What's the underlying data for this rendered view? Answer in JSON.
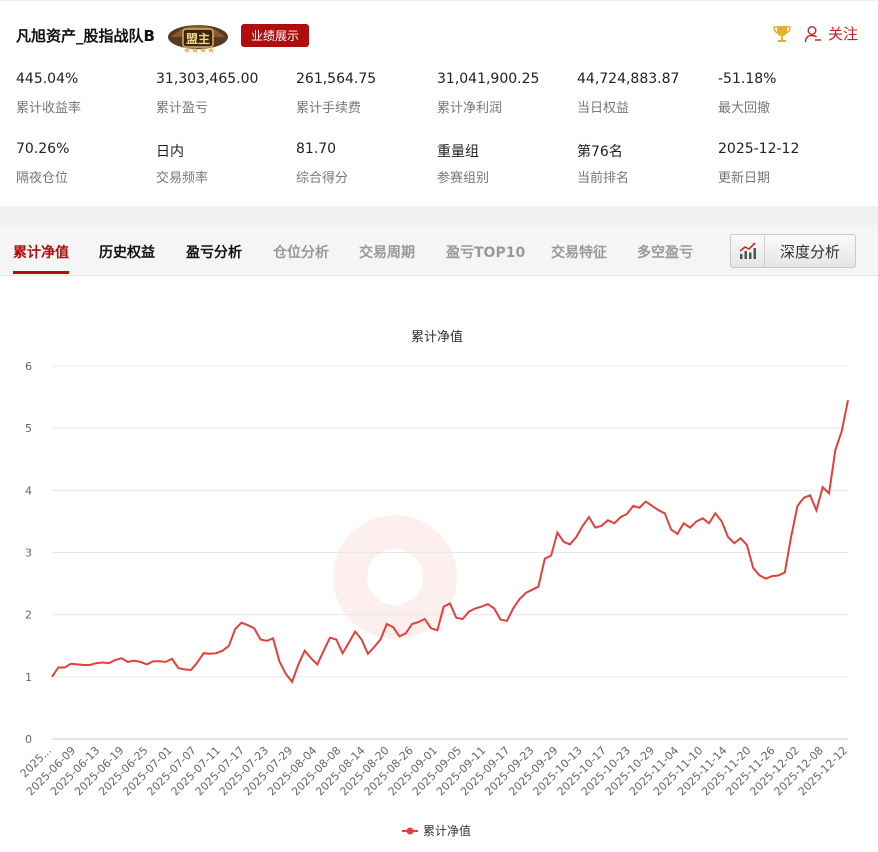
{
  "header": {
    "account_name": "凡旭资产_股指战队B",
    "badge_text": "盟主",
    "performance_button": "业绩展示",
    "follow_label": "关注"
  },
  "stats": [
    {
      "value": "445.04%",
      "label": "累计收益率"
    },
    {
      "value": "31,303,465.00",
      "label": "累计盈亏"
    },
    {
      "value": "261,564.75",
      "label": "累计手续费"
    },
    {
      "value": "31,041,900.25",
      "label": "累计净利润"
    },
    {
      "value": "44,724,883.87",
      "label": "当日权益"
    },
    {
      "value": "-51.18%",
      "label": "最大回撤"
    },
    {
      "value": "70.26%",
      "label": "隔夜仓位"
    },
    {
      "value": "日内",
      "label": "交易频率"
    },
    {
      "value": "81.70",
      "label": "综合得分"
    },
    {
      "value": "重量组",
      "label": "参赛组别"
    },
    {
      "value": "第76名",
      "label": "当前排名"
    },
    {
      "value": "2025-12-12",
      "label": "更新日期"
    }
  ],
  "tabs": [
    {
      "label": "累计净值",
      "state": "active"
    },
    {
      "label": "历史权益",
      "state": "dark"
    },
    {
      "label": "盈亏分析",
      "state": "dark"
    },
    {
      "label": "仓位分析",
      "state": "muted"
    },
    {
      "label": "交易周期",
      "state": "muted"
    },
    {
      "label": "盈亏TOP10",
      "state": "muted"
    },
    {
      "label": "交易特征",
      "state": "muted"
    },
    {
      "label": "多空盈亏",
      "state": "muted"
    }
  ],
  "deep_analysis_label": "深度分析",
  "colors": {
    "accent": "#b00e0e",
    "line": "#e0413b"
  },
  "chart_data": {
    "type": "line",
    "title": "累计净值",
    "legend": "累计净值",
    "legend_position": "bottom",
    "ylim": [
      0,
      6
    ],
    "yticks": [
      0,
      1,
      2,
      3,
      4,
      5,
      6
    ],
    "grid": true,
    "xtick_labels": [
      "2025...",
      "2025-06-09",
      "2025-06-13",
      "2025-06-19",
      "2025-06-25",
      "2025-07-01",
      "2025-07-07",
      "2025-07-11",
      "2025-07-17",
      "2025-07-23",
      "2025-07-29",
      "2025-08-04",
      "2025-08-08",
      "2025-08-14",
      "2025-08-20",
      "2025-08-26",
      "2025-09-01",
      "2025-09-05",
      "2025-09-11",
      "2025-09-17",
      "2025-09-23",
      "2025-09-29",
      "2025-10-13",
      "2025-10-17",
      "2025-10-23",
      "2025-10-29",
      "2025-11-04",
      "2025-11-10",
      "2025-11-14",
      "2025-11-20",
      "2025-11-26",
      "2025-12-02",
      "2025-12-08",
      "2025-12-12"
    ],
    "series": [
      {
        "name": "累计净值",
        "values": [
          1.0,
          1.15,
          1.15,
          1.21,
          1.2,
          1.19,
          1.19,
          1.22,
          1.23,
          1.22,
          1.27,
          1.3,
          1.24,
          1.26,
          1.24,
          1.2,
          1.25,
          1.25,
          1.24,
          1.29,
          1.14,
          1.12,
          1.11,
          1.23,
          1.38,
          1.37,
          1.38,
          1.42,
          1.5,
          1.77,
          1.87,
          1.83,
          1.78,
          1.6,
          1.58,
          1.62,
          1.25,
          1.05,
          0.92,
          1.2,
          1.42,
          1.3,
          1.2,
          1.42,
          1.63,
          1.6,
          1.38,
          1.55,
          1.73,
          1.6,
          1.37,
          1.48,
          1.6,
          1.85,
          1.8,
          1.65,
          1.7,
          1.85,
          1.88,
          1.93,
          1.78,
          1.75,
          2.13,
          2.18,
          1.95,
          1.93,
          2.05,
          2.1,
          2.13,
          2.17,
          2.1,
          1.92,
          1.9,
          2.1,
          2.25,
          2.35,
          2.4,
          2.45,
          2.9,
          2.95,
          3.32,
          3.17,
          3.13,
          3.25,
          3.43,
          3.57,
          3.4,
          3.43,
          3.52,
          3.47,
          3.57,
          3.62,
          3.75,
          3.72,
          3.82,
          3.75,
          3.68,
          3.63,
          3.37,
          3.3,
          3.47,
          3.4,
          3.5,
          3.55,
          3.47,
          3.63,
          3.5,
          3.25,
          3.15,
          3.23,
          3.12,
          2.75,
          2.63,
          2.58,
          2.62,
          2.63,
          2.68,
          3.25,
          3.75,
          3.88,
          3.92,
          3.68,
          4.05,
          3.95,
          4.65,
          4.95,
          5.45
        ]
      }
    ]
  }
}
